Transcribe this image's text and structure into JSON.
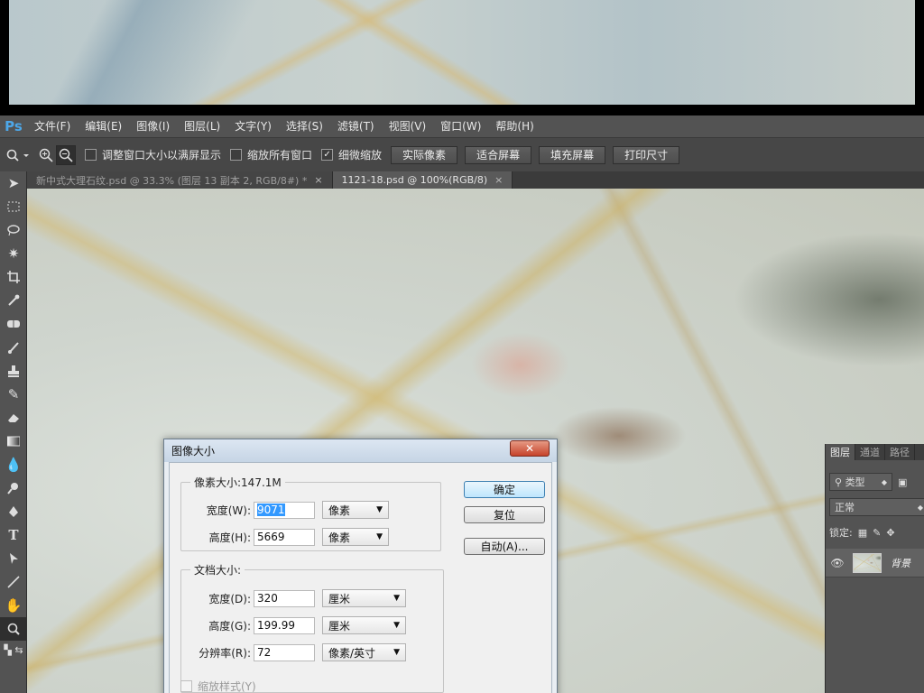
{
  "app": {
    "logo": "Ps"
  },
  "menubar": {
    "items": [
      "文件(F)",
      "编辑(E)",
      "图像(I)",
      "图层(L)",
      "文字(Y)",
      "选择(S)",
      "滤镜(T)",
      "视图(V)",
      "窗口(W)",
      "帮助(H)"
    ]
  },
  "options": {
    "resize_window": "调整窗口大小以满屏显示",
    "zoom_all": "缩放所有窗口",
    "scrubby_zoom": "细微缩放",
    "scrubby_checked": true,
    "buttons": [
      "实际像素",
      "适合屏幕",
      "填充屏幕",
      "打印尺寸"
    ]
  },
  "tabs": [
    {
      "label": "新中式大理石纹.psd @ 33.3% (图层 13 副本 2, RGB/8#) *",
      "close": "×",
      "active": false
    },
    {
      "label": "1121-18.psd @ 100%(RGB/8)",
      "close": "×",
      "active": true
    }
  ],
  "tools": [
    "move",
    "marquee",
    "lasso",
    "magic-wand",
    "crop",
    "eyedropper",
    "healing",
    "brush",
    "stamp",
    "history-brush",
    "eraser",
    "gradient",
    "blur",
    "dodge",
    "pen",
    "type",
    "path-select",
    "line",
    "hand",
    "zoom"
  ],
  "dialog": {
    "title": "图像大小",
    "close": "✕",
    "pixel_dims": {
      "title": "像素大小:147.1M",
      "width_label": "宽度(W):",
      "width_value": "9071",
      "width_unit": "像素",
      "height_label": "高度(H):",
      "height_value": "5669",
      "height_unit": "像素"
    },
    "doc_size": {
      "title": "文档大小:",
      "width_label": "宽度(D):",
      "width_value": "320",
      "width_unit": "厘米",
      "height_label": "高度(G):",
      "height_value": "199.99",
      "height_unit": "厘米",
      "res_label": "分辨率(R):",
      "res_value": "72",
      "res_unit": "像素/英寸"
    },
    "scale_styles": "缩放样式(Y)",
    "ok": "确定",
    "reset": "复位",
    "auto": "自动(A)..."
  },
  "layers_panel": {
    "tabs": [
      "图层",
      "通道",
      "路径"
    ],
    "filter": "类型",
    "blend_mode": "正常",
    "lock_label": "锁定:",
    "layer_name": "背景"
  }
}
